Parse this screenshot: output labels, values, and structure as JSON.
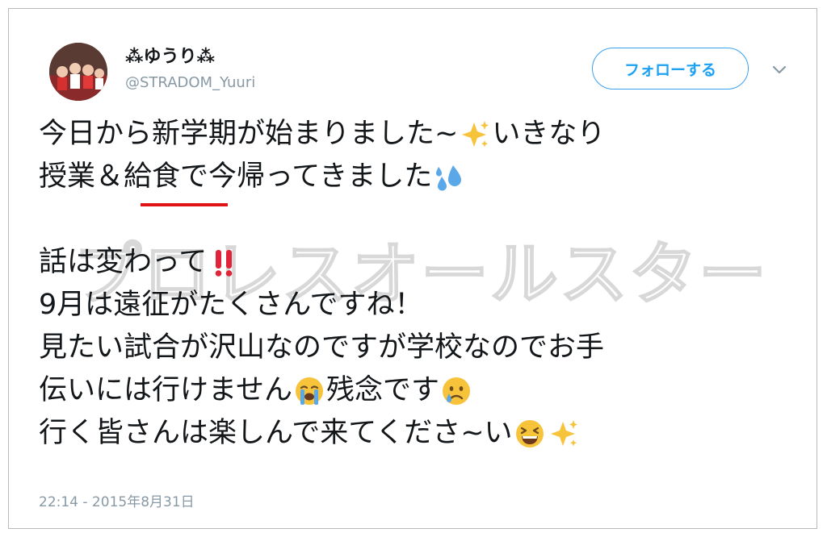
{
  "tweet": {
    "display_name": "⁂ゆうり⁂",
    "handle": "@STRADOM_Yuuri",
    "follow_label": "フォローする",
    "timestamp": "22:14 - 2015年8月31日",
    "lines": [
      "今日から新学期が始まりました~",
      "いきなり",
      "授業＆",
      "給食",
      "で今帰ってきました",
      "話は変わって",
      "9月は遠征がたくさんですね！",
      "見たい試合が沢山なのですが学校なのでお手",
      "伝いには行けません",
      "残念です",
      "行く皆さんは楽しんで来てくださ~い"
    ]
  },
  "watermark": "プロレスオールスター",
  "icons": {
    "caret": "chevron-down-icon",
    "sparkles": "sparkles-icon",
    "sweat": "sweat-droplets-icon",
    "exclamation": "double-exclamation-icon",
    "crying": "loudly-crying-face-icon",
    "sad_tear": "crying-face-icon",
    "laughing": "laughing-face-icon"
  },
  "colors": {
    "accent": "#1da1f2",
    "underline": "#e01414",
    "muted": "#8899a6"
  }
}
